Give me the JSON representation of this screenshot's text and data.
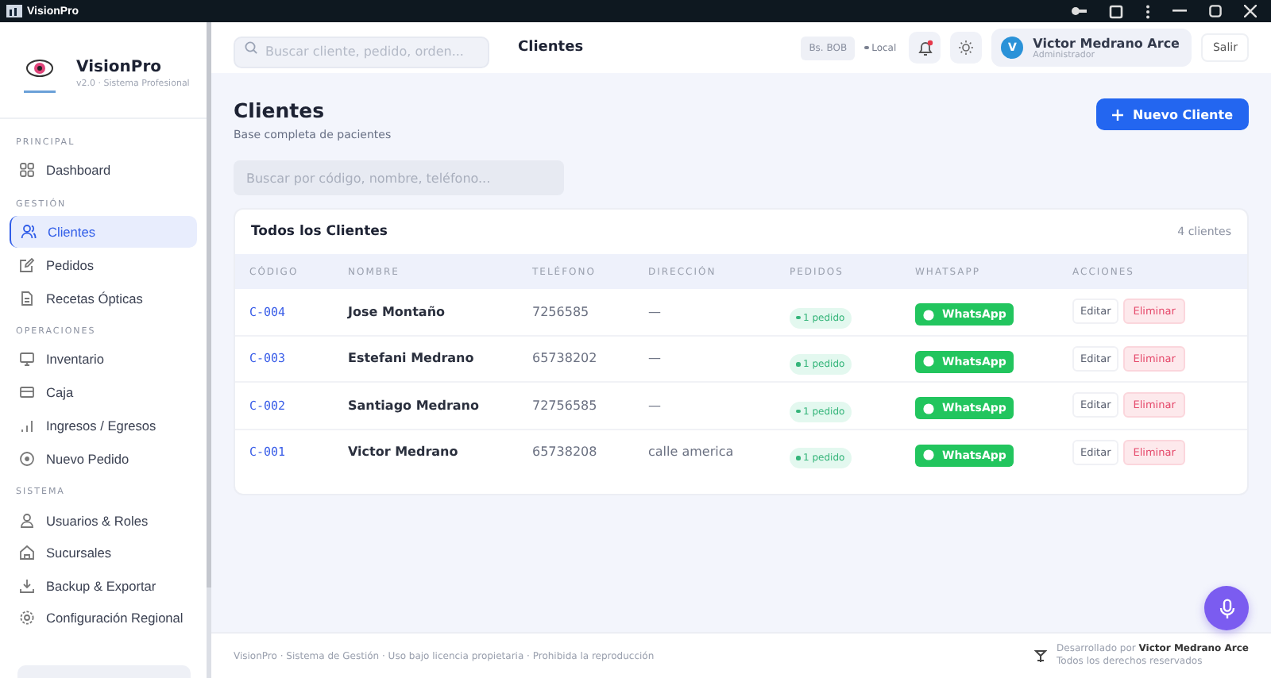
{
  "window": {
    "title": "VisionPro"
  },
  "brand": {
    "name": "VisionPro",
    "subtitle": "v2.0 · Sistema Profesional"
  },
  "nav": [
    {
      "title": "PRINCIPAL",
      "items": [
        {
          "label": "Dashboard",
          "selected": false
        }
      ]
    },
    {
      "title": "GESTIÓN",
      "items": [
        {
          "label": "Clientes",
          "selected": true
        },
        {
          "label": "Pedidos",
          "selected": false
        },
        {
          "label": "Recetas Ópticas",
          "selected": false
        }
      ]
    },
    {
      "title": "OPERACIONES",
      "items": [
        {
          "label": "Inventario",
          "selected": false
        },
        {
          "label": "Caja",
          "selected": false
        },
        {
          "label": "Ingresos / Egresos",
          "selected": false
        },
        {
          "label": "Nuevo Pedido",
          "selected": false
        }
      ]
    },
    {
      "title": "SISTEMA",
      "items": [
        {
          "label": "Usuarios & Roles",
          "selected": false
        },
        {
          "label": "Sucursales",
          "selected": false
        },
        {
          "label": "Backup & Exportar",
          "selected": false
        },
        {
          "label": "Configuración Regional",
          "selected": false
        }
      ]
    }
  ],
  "topbar": {
    "search_placeholder": "Buscar cliente, pedido, orden...",
    "page_title": "Clientes",
    "currency": "Bs. BOB",
    "mode": "Local",
    "has_notification": true,
    "user": {
      "initial": "V",
      "name": "Victor Medrano Arce",
      "role": "Administrador"
    },
    "logout": "Salir"
  },
  "page": {
    "title": "Clientes",
    "subtitle": "Base completa de pacientes",
    "new_button": "Nuevo Cliente",
    "filter_placeholder": "Buscar por código, nombre, teléfono..."
  },
  "table": {
    "title": "Todos los Clientes",
    "count": "4 clientes",
    "columns": [
      "CÓDIGO",
      "NOMBRE",
      "TELÉFONO",
      "DIRECCIÓN",
      "PEDIDOS",
      "WHATSAPP",
      "ACCIONES"
    ],
    "rows": [
      {
        "code": "C-004",
        "name": "Jose Montaño",
        "phone": "7256585",
        "address": "—",
        "orders": "1 pedido",
        "whatsapp": "WhatsApp",
        "edit": "Editar",
        "delete": "Eliminar"
      },
      {
        "code": "C-003",
        "name": "Estefani Medrano",
        "phone": "65738202",
        "address": "—",
        "orders": "1 pedido",
        "whatsapp": "WhatsApp",
        "edit": "Editar",
        "delete": "Eliminar"
      },
      {
        "code": "C-002",
        "name": "Santiago Medrano",
        "phone": "72756585",
        "address": "—",
        "orders": "1 pedido",
        "whatsapp": "WhatsApp",
        "edit": "Editar",
        "delete": "Eliminar"
      },
      {
        "code": "C-001",
        "name": "Victor Medrano",
        "phone": "65738208",
        "address": "calle america",
        "orders": "1 pedido",
        "whatsapp": "WhatsApp",
        "edit": "Editar",
        "delete": "Eliminar"
      }
    ]
  },
  "footer": {
    "left": "VisionPro · Sistema de Gestión · Uso bajo licencia propietaria · Prohibida la reproducción",
    "credit": "Desarrollado por **Victor Medrano Arce**",
    "rights": "Todos los derechos reservados"
  }
}
